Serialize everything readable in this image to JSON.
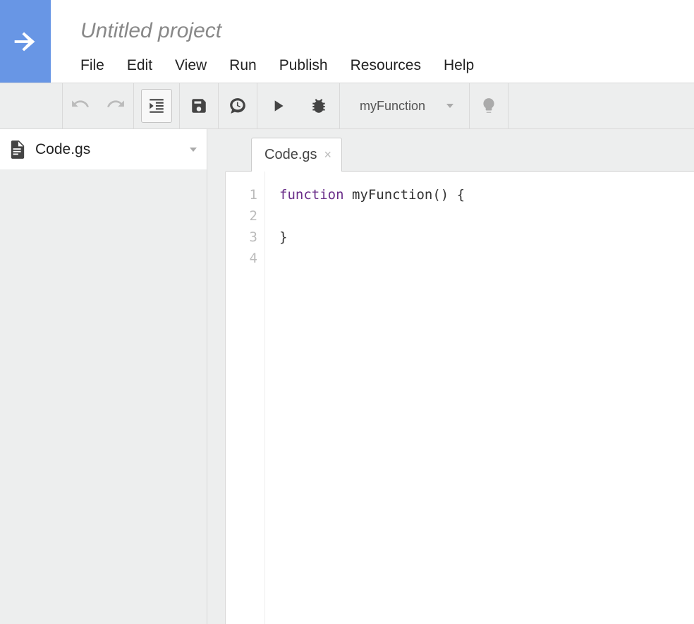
{
  "header": {
    "project_title": "Untitled project",
    "menu": {
      "file": "File",
      "edit": "Edit",
      "view": "View",
      "run": "Run",
      "publish": "Publish",
      "resources": "Resources",
      "help": "Help"
    }
  },
  "toolbar": {
    "function_selected": "myFunction"
  },
  "sidebar": {
    "files": [
      {
        "name": "Code.gs"
      }
    ]
  },
  "editor": {
    "tab_label": "Code.gs",
    "line_numbers": [
      "1",
      "2",
      "3",
      "4"
    ],
    "code": {
      "keyword": "function",
      "rest_line1": " myFunction() {",
      "line2": "  ",
      "line3": "}",
      "line4": ""
    }
  }
}
